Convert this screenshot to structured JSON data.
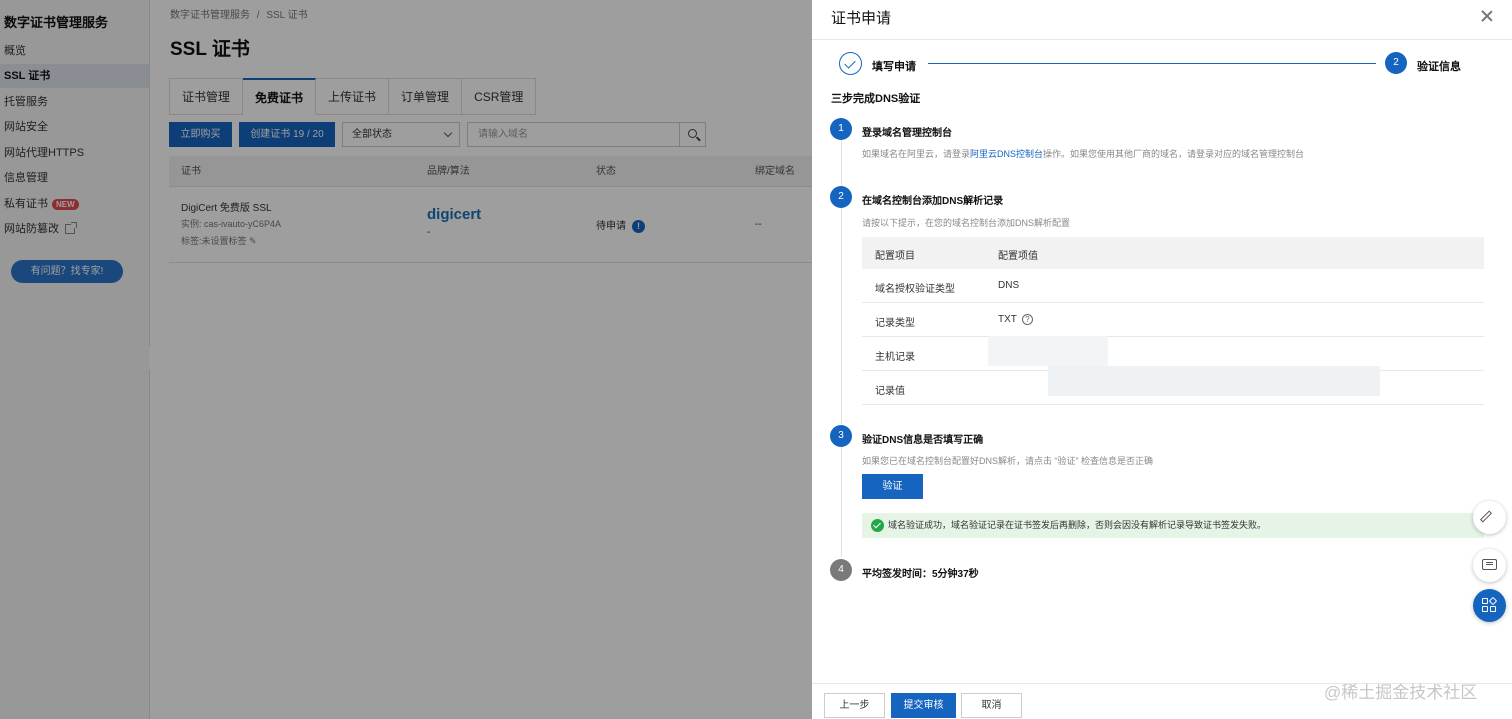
{
  "sidebar": {
    "title": "数字证书管理服务",
    "items": [
      {
        "label": "概览"
      },
      {
        "label": "SSL 证书"
      },
      {
        "label": "托管服务"
      },
      {
        "label": "网站安全"
      },
      {
        "label": "网站代理HTTPS"
      },
      {
        "label": "信息管理"
      },
      {
        "label": "私有证书",
        "badge": "NEW"
      },
      {
        "label": "网站防篡改"
      }
    ],
    "active_index": 1,
    "help_button": "有问题？找专家!",
    "collapse_glyph": "‹"
  },
  "main": {
    "breadcrumb": [
      "数字证书管理服务",
      "/",
      "SSL 证书"
    ],
    "page_title": "SSL 证书",
    "tabs": [
      {
        "label": "证书管理"
      },
      {
        "label": "免费证书"
      },
      {
        "label": "上传证书"
      },
      {
        "label": "订单管理"
      },
      {
        "label": "CSR管理"
      }
    ],
    "active_tab": 1,
    "toolbar": {
      "buy_now": "立即购买",
      "create_cert": "创建证书 19 / 20",
      "status_select": "全部状态",
      "search_placeholder": "请输入域名"
    },
    "table": {
      "headers": [
        "证书",
        "品牌/算法",
        "状态",
        "绑定域名"
      ],
      "rows": [
        {
          "cert_name": "DigiCert 免费版 SSL",
          "instance": "实例: cas-ivauto-yC6P4A",
          "tag": "标签:未设置标签",
          "brand_logo": "digicert",
          "algorithm": "-",
          "status": "待申请",
          "domain": "--"
        }
      ]
    }
  },
  "drawer": {
    "title": "证书申请",
    "steps": [
      {
        "label": "填写申请",
        "state": "done"
      },
      {
        "number": "2",
        "label": "验证信息",
        "state": "active"
      }
    ],
    "intro": "三步完成DNS验证",
    "sections": [
      {
        "number": "1",
        "title": "登录域名管理控制台",
        "desc_before": "如果域名在阿里云，请登录",
        "desc_link": "阿里云DNS控制台",
        "desc_after": "操作。如果您使用其他厂商的域名，请登录对应的域名管理控制台"
      },
      {
        "number": "2",
        "title": "在域名控制台添加DNS解析记录",
        "desc": "请按以下提示，在您的域名控制台添加DNS解析配置"
      },
      {
        "number": "3",
        "title": "验证DNS信息是否填写正确",
        "desc": "如果您已在域名控制台配置好DNS解析，请点击 “验证” 检查信息是否正确"
      },
      {
        "number": "4",
        "title": "平均签发时间：5分钟37秒"
      }
    ],
    "config_table": {
      "headers": [
        "配置项目",
        "配置项值"
      ],
      "rows": [
        {
          "key": "域名授权验证类型",
          "value": "DNS"
        },
        {
          "key": "记录类型",
          "value": "TXT"
        },
        {
          "key": "主机记录",
          "value": ""
        },
        {
          "key": "记录值",
          "value": ""
        }
      ]
    },
    "verify_button": "验证",
    "success_message": "域名验证成功，域名验证记录在证书签发后再删除，否则会因没有解析记录导致证书签发失败。",
    "footer": {
      "prev": "上一步",
      "submit": "提交审核",
      "cancel": "取消"
    }
  },
  "watermark": "@稀土掘金技术社区",
  "colors": {
    "primary": "#1565c0",
    "success_bg": "#e6f4e6",
    "success_icon": "#22a84a",
    "badge": "#e5484d"
  }
}
